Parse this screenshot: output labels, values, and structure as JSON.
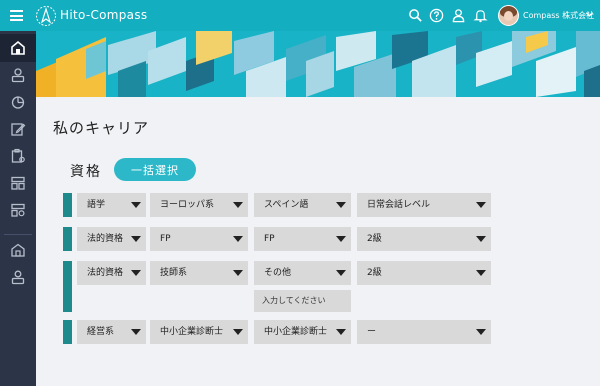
{
  "header": {
    "brand": "Hito-Compass",
    "company": "Compass 株式会社",
    "icons": [
      "menu-icon",
      "search-icon",
      "help-icon",
      "user-icon",
      "bell-icon",
      "chevron-down-icon"
    ]
  },
  "sidebar": {
    "items": [
      "home-icon",
      "profile-icon",
      "chart-icon",
      "edit-icon",
      "clipboard-gear-icon",
      "layout-icon",
      "layout-gear-icon",
      "building-icon",
      "people-icon"
    ]
  },
  "page": {
    "title": "私のキャリア",
    "section_title": "資格",
    "bulk_select_label": "一括選択"
  },
  "qualifications": {
    "rows": [
      {
        "c1": "語学",
        "c2": "ヨーロッパ系",
        "c3": "スペイン語",
        "c4": "日常会話レベル"
      },
      {
        "c1": "法的資格",
        "c2": "FP",
        "c3": "FP",
        "c4": "2級"
      },
      {
        "c1": "法的資格",
        "c2": "技師系",
        "c3": "その他",
        "c4": "2級",
        "input_placeholder": "入力してください"
      },
      {
        "c1": "経営系",
        "c2": "中小企業診断士",
        "c3": "中小企業診断士",
        "c4": "ー"
      }
    ]
  },
  "colors": {
    "topbar": "#13aebf",
    "sidebar": "#2c3547",
    "accent_button": "#2db8c9",
    "row_marker": "#1f8a8b",
    "select_bg": "#d9d9d9"
  }
}
